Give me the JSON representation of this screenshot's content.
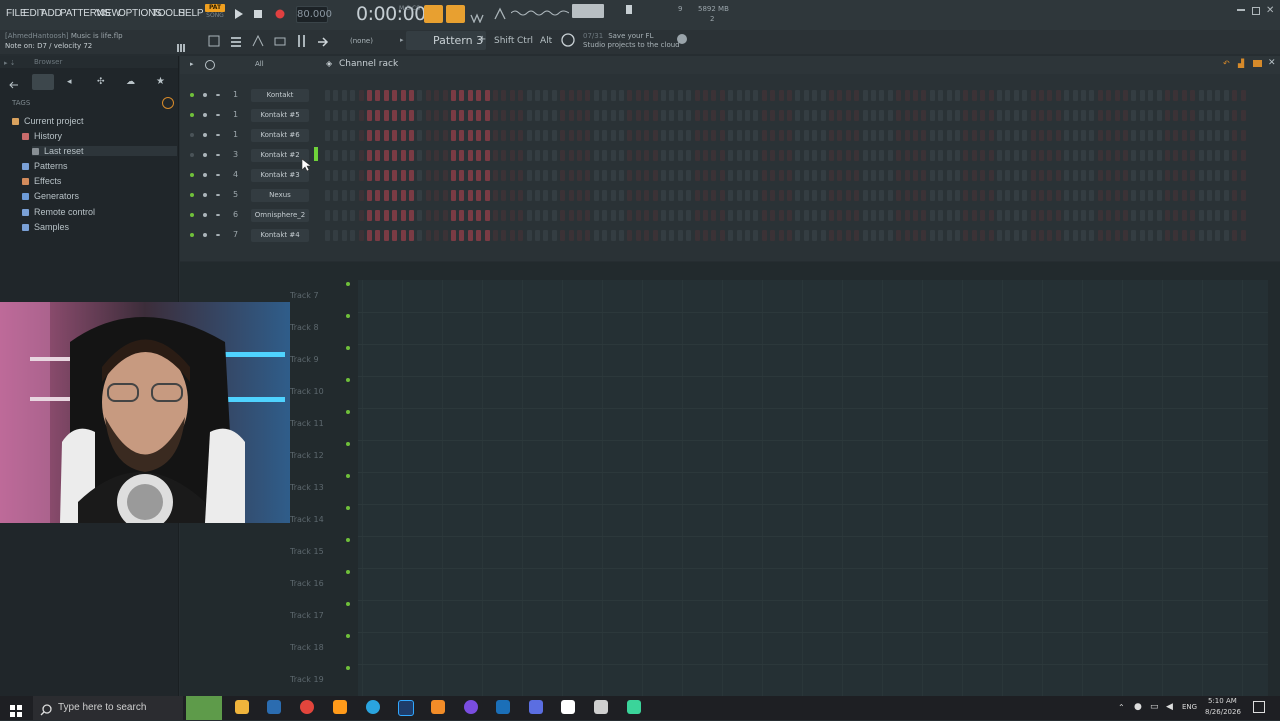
{
  "menu": [
    "FILE",
    "EDIT",
    "ADD",
    "PATTERNS",
    "VIEW",
    "OPTIONS",
    "TOOLS",
    "HELP"
  ],
  "mode": {
    "pat": "PAT",
    "song": "SONG"
  },
  "transport": {
    "tempo": "80.000",
    "time": "0:00:00",
    "time_unit": "M:S:CS"
  },
  "status": {
    "ram": "5892 MB",
    "cpu": "2",
    "voices": "9"
  },
  "hint": {
    "user": "[AhmedHantoosh]",
    "project": "Music is life.flp",
    "note": "Note on: D7 / velocity 72"
  },
  "toolbar": {
    "none_label": "(none)",
    "pattern": "Pattern 3",
    "mod_keys": [
      "Shift",
      "Ctrl",
      "Alt"
    ],
    "cloud_count": "07/31",
    "cloud_msg_1": "Save your FL",
    "cloud_msg_2": "Studio projects to the cloud"
  },
  "browser": {
    "label": "Browser",
    "tags": "TAGS",
    "tree": [
      {
        "label": "Current project",
        "color": "#d9a25e"
      },
      {
        "label": "History",
        "color": "#c96b6b"
      },
      {
        "label": "Last reset",
        "color": "#888f94"
      },
      {
        "label": "Patterns",
        "color": "#7aa0d6"
      },
      {
        "label": "Effects",
        "color": "#d38b5c"
      },
      {
        "label": "Generators",
        "color": "#6c9bd8"
      },
      {
        "label": "Remote control",
        "color": "#7aa0d6"
      },
      {
        "label": "Samples",
        "color": "#7aa0d6"
      }
    ]
  },
  "rack": {
    "title": "Channel rack",
    "filter": "All",
    "channels": [
      {
        "num": "1",
        "name": "Kontakt"
      },
      {
        "num": "1",
        "name": "Kontakt #5"
      },
      {
        "num": "1",
        "name": "Kontakt #6"
      },
      {
        "num": "3",
        "name": "Kontakt #2"
      },
      {
        "num": "4",
        "name": "Kontakt #3"
      },
      {
        "num": "5",
        "name": "Nexus"
      },
      {
        "num": "6",
        "name": "Omnisphere_2"
      },
      {
        "num": "7",
        "name": "Kontakt #4"
      }
    ],
    "add": "+"
  },
  "playlist": {
    "tracks": [
      "Track 7",
      "Track 8",
      "Track 9",
      "Track 10",
      "Track 11",
      "Track 12",
      "Track 13",
      "Track 14",
      "Track 15",
      "Track 16",
      "Track 17",
      "Track 18",
      "Track 19"
    ]
  },
  "taskbar": {
    "search": "Type here to search",
    "lang": "ENG",
    "time": "5:10 AM",
    "date": "8/26/2026"
  },
  "colors": {
    "accent": "#f0a020",
    "step_active": "#6e3a40",
    "step_inactive": "#353e43",
    "led": "#6fbf3a"
  }
}
